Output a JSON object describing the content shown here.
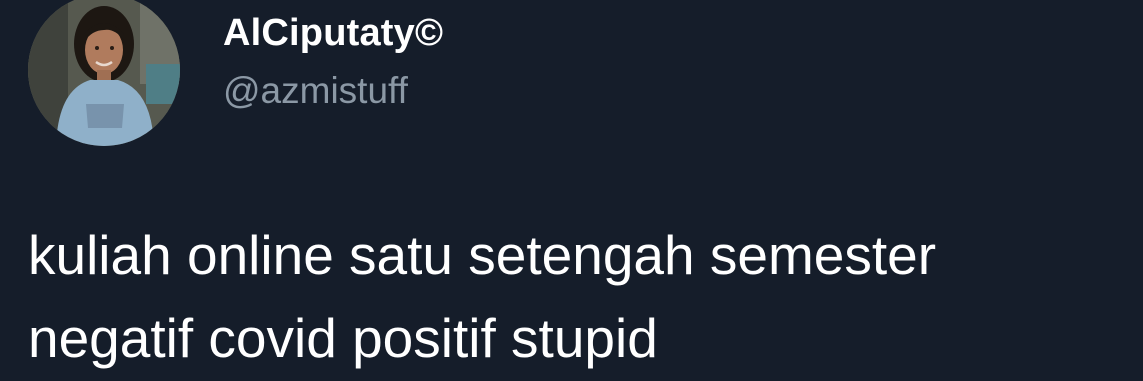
{
  "tweet": {
    "author": {
      "display_name": "AlCiputaty©",
      "handle": "@azmistuff",
      "avatar_icon": "profile-photo-avatar"
    },
    "text_lines": [
      "kuliah online satu setengah semester",
      "negatif covid positif stupid"
    ]
  },
  "colors": {
    "background": "#151d2a",
    "name": "#ffffff",
    "handle": "#8b98a5",
    "text": "#ffffff"
  }
}
